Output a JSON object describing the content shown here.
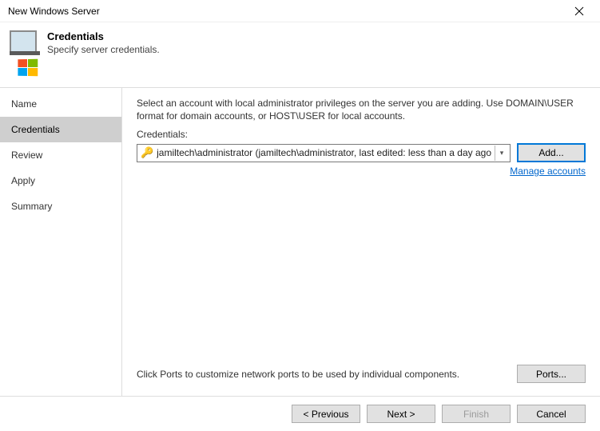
{
  "window": {
    "title": "New Windows Server"
  },
  "header": {
    "title": "Credentials",
    "subtitle": "Specify server credentials."
  },
  "sidebar": {
    "steps": [
      {
        "label": "Name",
        "active": false
      },
      {
        "label": "Credentials",
        "active": true
      },
      {
        "label": "Review",
        "active": false
      },
      {
        "label": "Apply",
        "active": false
      },
      {
        "label": "Summary",
        "active": false
      }
    ]
  },
  "content": {
    "description": "Select an account with local administrator privileges on the server you are adding. Use DOMAIN\\USER format for domain accounts, or HOST\\USER for local accounts.",
    "credentials_label": "Credentials:",
    "selected_credential": "jamiltech\\administrator (jamiltech\\administrator, last edited: less than a day ago",
    "add_button": "Add...",
    "manage_link": "Manage accounts",
    "ports_text": "Click Ports to customize network ports to be used by individual components.",
    "ports_button": "Ports..."
  },
  "footer": {
    "previous": "< Previous",
    "next": "Next >",
    "finish": "Finish",
    "cancel": "Cancel"
  }
}
